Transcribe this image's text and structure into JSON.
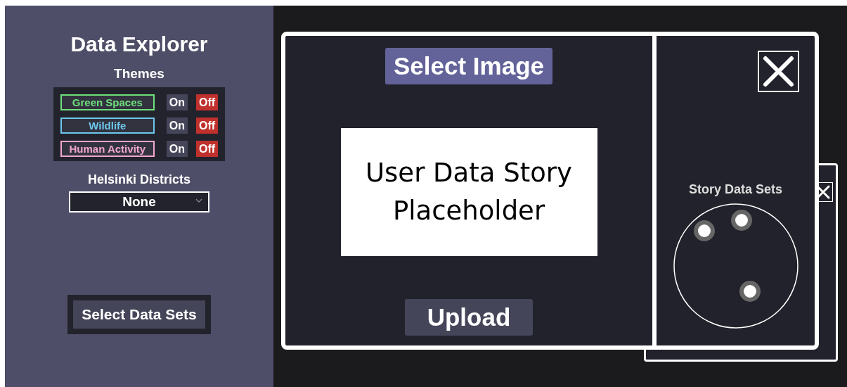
{
  "sidebar": {
    "title": "Data Explorer",
    "themes_heading": "Themes",
    "themes": [
      {
        "label": "Green Spaces",
        "color": "#6ee07c",
        "on": false,
        "on_label": "On",
        "off_label": "Off"
      },
      {
        "label": "Wildlife",
        "color": "#6cc8ec",
        "on": false,
        "on_label": "On",
        "off_label": "Off"
      },
      {
        "label": "Human Activity",
        "color": "#f2a6cf",
        "on": false,
        "on_label": "On",
        "off_label": "Off"
      }
    ],
    "districts_heading": "Helsinki Districts",
    "districts_dropdown": {
      "value": "None"
    },
    "select_button": "Select Data Sets"
  },
  "story_window": {
    "select_image_button": "Select Image",
    "placeholder_text": "User Data Story Placeholder",
    "upload_button": "Upload",
    "data_sets_heading": "Story Data Sets"
  }
}
